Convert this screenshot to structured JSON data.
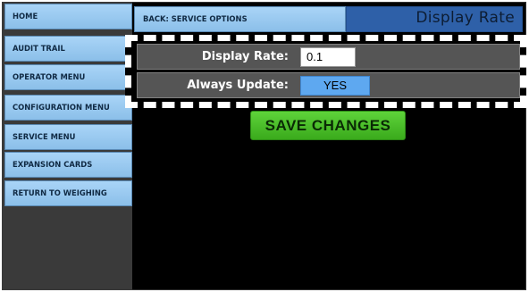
{
  "sidebar": {
    "items": [
      {
        "label": "HOME"
      },
      {
        "label": "AUDIT TRAIL"
      },
      {
        "label": "OPERATOR MENU"
      },
      {
        "label": "CONFIGURATION MENU"
      },
      {
        "label": "SERVICE MENU"
      },
      {
        "label": "EXPANSION CARDS"
      },
      {
        "label": "RETURN TO WEIGHING"
      }
    ]
  },
  "header": {
    "back_label": "BACK: SERVICE OPTIONS",
    "title": "Display Rate"
  },
  "settings": {
    "display_rate": {
      "label": "Display Rate:",
      "value": "0.1"
    },
    "always_update": {
      "label": "Always Update:",
      "value": "YES"
    }
  },
  "actions": {
    "save_label": "SAVE  CHANGES"
  },
  "colors": {
    "nav_button": "#a9d4f7",
    "title_accent": "#2e60a8",
    "save_button": "#4cc22a",
    "toggle_on": "#5ea8f0",
    "highlight_border": "#ffffff"
  }
}
